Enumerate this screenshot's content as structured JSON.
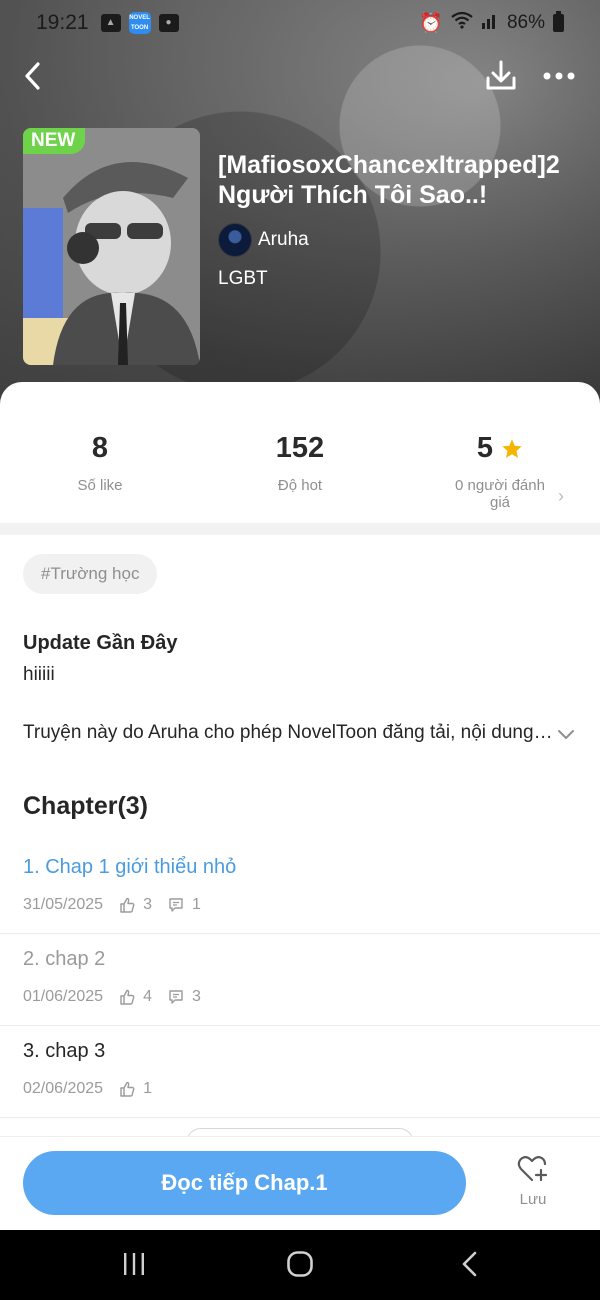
{
  "status_bar": {
    "time": "19:21",
    "novel_icon_text": "NOVEL TOON",
    "battery": "86%"
  },
  "book": {
    "badge": "NEW",
    "title": "[MafiosoxChancexItrapped]2 Người Thích Tôi Sao..!",
    "author": "Aruha",
    "genre": "LGBT"
  },
  "stats": [
    {
      "value": "8",
      "label": "Số like"
    },
    {
      "value": "152",
      "label": "Độ hot"
    },
    {
      "value": "5",
      "label": "0 người đánh giá"
    }
  ],
  "tag": "#Trường học",
  "update": {
    "title": "Update Gần Đây",
    "text": "hiiiii"
  },
  "description": "Truyện này do Aruha cho phép NovelToon đăng tải, nội dung truyện",
  "chapters_title": "Chapter(3)",
  "chapters": [
    {
      "title": "1. Chap 1 giới thiểu nhỏ",
      "date": "31/05/2025",
      "likes": "3",
      "comments": "1",
      "color": "#4a9be0"
    },
    {
      "title": "2. chap 2",
      "date": "01/06/2025",
      "likes": "4",
      "comments": "3",
      "color": "#9a9a9a"
    },
    {
      "title": "3. chap 3",
      "date": "02/06/2025",
      "likes": "1",
      "comments": "",
      "color": "#262626"
    }
  ],
  "actions": {
    "read_label": "Đọc tiếp Chap.1",
    "save_label": "Lưu"
  },
  "colors": {
    "accent": "#5aa8f2",
    "badge_new": "#6ed34a",
    "star": "#f5b400"
  }
}
